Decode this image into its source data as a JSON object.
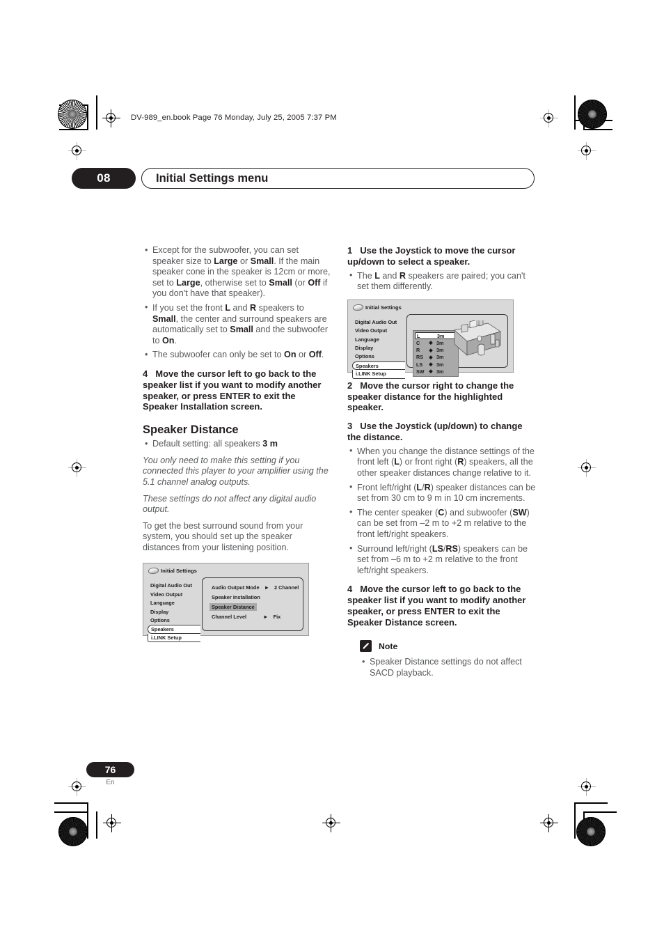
{
  "header": {
    "file_line": "DV-989_en.book  Page 76  Monday, July 25, 2005  7:37 PM"
  },
  "chapter": {
    "number": "08",
    "title": "Initial Settings menu"
  },
  "left_column": {
    "bullets_top": [
      "Except for the subwoofer, you can set speaker size to <b>Large</b> or <b>Small</b>. If the main speaker cone in the speaker is 12cm or more, set to <b>Large</b>, otherwise set to <b>Small</b> (or <b>Off</b> if you don't have that speaker).",
      "If you set the front <b>L</b> and <b>R</b> speakers to <b>Small</b>, the center and surround speakers are automatically set to <b>Small</b> and the subwoofer to <b>On</b>.",
      "The subwoofer can only be set to <b>On</b> or <b>Off</b>."
    ],
    "step4": {
      "number": "4",
      "text": "Move the cursor left to go back to the speaker list if you want to modify another speaker, or press ENTER to exit the Speaker Installation screen."
    },
    "section_heading": "Speaker Distance",
    "default_bullet": "Default setting: all speakers <b>3 m</b>",
    "italic_1": "You only need to make this setting if you connected this player to your amplifier using the 5.1 channel analog outputs.",
    "italic_2": "These settings do not affect any digital audio output.",
    "paragraph": "To get the best surround sound from your system, you should set up the speaker distances from your listening position."
  },
  "right_column": {
    "step1": {
      "number": "1",
      "text": "Use the Joystick to move the cursor up/down to select a speaker."
    },
    "step1_bullets": [
      "The <b>L</b> and <b>R</b> speakers are paired; you can't set them differently."
    ],
    "step2": {
      "number": "2",
      "text": "Move the cursor right to change the speaker distance for the highlighted speaker."
    },
    "step3": {
      "number": "3",
      "text": "Use the Joystick (up/down) to change the distance."
    },
    "step3_bullets": [
      "When you change the distance settings of the front left (<b>L</b>) or front right (<b>R</b>) speakers, all the other speaker distances change relative to it.",
      "Front left/right (<b>L</b>/<b>R</b>) speaker distances can be set from 30 cm to 9 m in 10 cm increments.",
      "The center speaker (<b>C</b>) and subwoofer (<b>SW</b>) can be set from &ndash;2 m to +2 m relative to the front left/right speakers.",
      "Surround left/right (<b>LS</b>/<b>RS</b>) speakers can be set from &ndash;6 m to +2 m relative to the front left/right speakers."
    ],
    "step4": {
      "number": "4",
      "text": "Move the cursor left to go back to the speaker list if you want to modify another speaker, or press ENTER to exit the Speaker Distance screen."
    },
    "note": {
      "label": "Note",
      "icon": "pencil-icon",
      "bullets": [
        "Speaker Distance settings do not affect SACD playback."
      ]
    }
  },
  "osd_speaker_distance": {
    "title": "Initial Settings",
    "title_icon": "disc-icon",
    "menu_items": [
      "Digital Audio Out",
      "Video Output",
      "Language",
      "Display",
      "Options",
      "Speakers",
      "i.LINK Setup"
    ],
    "selected_menu_item": "Speakers",
    "speakers": [
      {
        "name": "L",
        "knob": "",
        "distance": "3m",
        "active": true
      },
      {
        "name": "C",
        "knob": "◆",
        "distance": "3m",
        "active": false
      },
      {
        "name": "R",
        "knob": "◆",
        "distance": "3m",
        "active": false
      },
      {
        "name": "RS",
        "knob": "◆",
        "distance": "3m",
        "active": false
      },
      {
        "name": "LS",
        "knob": "◆",
        "distance": "3m",
        "active": false
      },
      {
        "name": "SW",
        "knob": "◆",
        "distance": "3m",
        "active": false
      }
    ]
  },
  "osd_speakers_menu": {
    "title": "Initial Settings",
    "title_icon": "disc-icon",
    "menu_items": [
      "Digital Audio Out",
      "Video Output",
      "Language",
      "Display",
      "Options",
      "Speakers",
      "i.LINK Setup"
    ],
    "selected_menu_item": "Speakers",
    "rows": [
      {
        "label": "Audio Output Mode",
        "arrow": "►",
        "value": "2 Channel",
        "highlighted": false
      },
      {
        "label": "Speaker Installation",
        "arrow": "",
        "value": "",
        "highlighted": false
      },
      {
        "label": "Speaker Distance",
        "arrow": "",
        "value": "",
        "highlighted": true
      },
      {
        "label": "Channel Level",
        "arrow": "►",
        "value": "Fix",
        "highlighted": false
      }
    ]
  },
  "footer": {
    "page_number": "76",
    "language": "En"
  },
  "colors": {
    "ink": "#231f20",
    "body_grey": "#58595b",
    "osd_bg": "#d9d9d9"
  }
}
